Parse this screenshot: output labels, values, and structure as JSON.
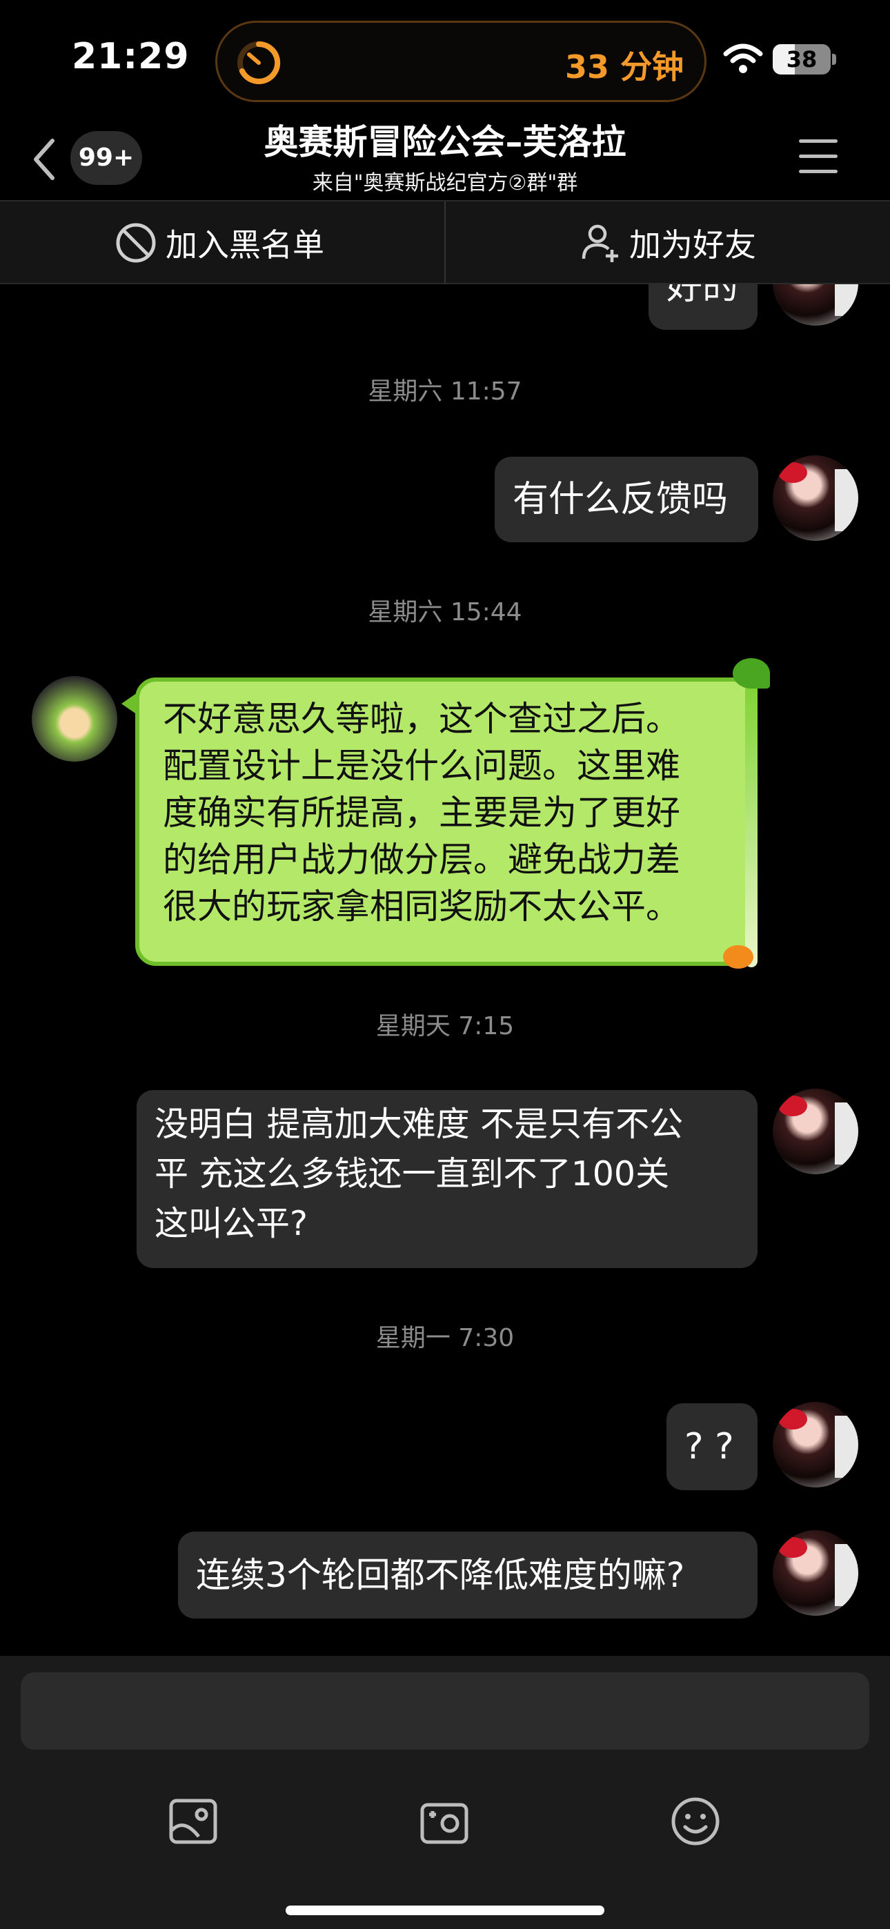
{
  "status_bar": {
    "time": "21:29",
    "activity_timer": "33 分钟",
    "battery_level": "38",
    "battery_fraction": 0.38,
    "accent_color": "#f39a2b"
  },
  "nav": {
    "unread_badge": "99+",
    "title": "奥赛斯冒险公会–芙洛拉",
    "subtitle": "来自\"奥赛斯战纪官方②群\"群",
    "back_icon": "chevron-left-icon",
    "menu_icon": "hamburger-menu-icon"
  },
  "actions": {
    "block_label": "加入黑名单",
    "block_icon": "block-icon",
    "add_friend_label": "加为好友",
    "add_friend_icon": "add-user-icon"
  },
  "messages": {
    "partial_top_text": "好的",
    "ts1": "星期六 11:57",
    "msg1": "有什么反馈吗",
    "ts2": "星期六 15:44",
    "msg2_lines": [
      "不好意思久等啦，这个查过之后。",
      "配置设计上是没什么问题。这里难",
      "度确实有所提高，主要是为了更好",
      "的给用户战力做分层。避免战力差",
      "很大的玩家拿相同奖励不太公平。"
    ],
    "msg2_bubble_color": "#b4e868",
    "ts3": "星期天 7:15",
    "msg3_lines": [
      "没明白 提高加大难度 不是只有不公",
      "平 充这么多钱还一直到不了100关",
      "这叫公平?"
    ],
    "ts4": "星期一 7:30",
    "msg4": "? ?",
    "msg5": "连续3个轮回都不降低难度的嘛?"
  },
  "input": {
    "placeholder": "",
    "tools": [
      "image-icon",
      "camera-icon",
      "emoji-icon"
    ]
  }
}
